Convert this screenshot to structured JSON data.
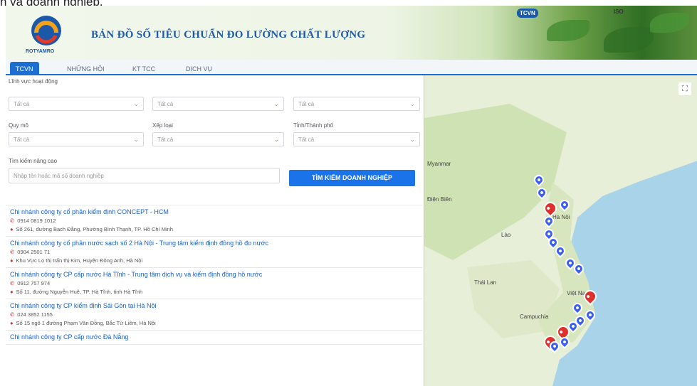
{
  "page": {
    "caption": "n và doanh nghiệp."
  },
  "banner": {
    "logo_text": "ROTYAMRO",
    "title": "BẢN ĐỒ SỐ TIÊU CHUẨN ĐO LƯỜNG CHẤT LƯỢNG",
    "badges": [
      "TCVN",
      "ISO"
    ]
  },
  "tabs": [
    {
      "label": "TCVN"
    },
    {
      "label": "NHỮNG HỘI"
    },
    {
      "label": "KT TCC"
    },
    {
      "label": "DỊCH VỤ"
    }
  ],
  "filters": {
    "group1_label": "Lĩnh vực hoạt động",
    "select1": "Tất cả",
    "select2": "Tất cả",
    "select3": "Tất cả",
    "label_a": "Quy mô",
    "label_b": "Xếp loại",
    "label_c": "Tỉnh/Thành phố",
    "select4": "Tất cả",
    "select5": "Tất cả",
    "select6": "Tất cả",
    "search_label": "Tìm kiếm nâng cao",
    "search_placeholder": "Nhập tên hoặc mã số doanh nghiệp",
    "search_button": "TÌM KIẾM DOANH NGHIỆP"
  },
  "results": [
    {
      "title": "Chi nhánh công ty cổ phần kiểm định CONCEPT - HCM",
      "phone": "0914 0819 1012",
      "address": "Số 261, đường Bạch Đằng, Phường Bình Thạnh, TP. Hồ Chí Minh"
    },
    {
      "title": "Chi nhánh công ty cổ phần nước sạch số 2 Hà Nội - Trung tâm kiểm định đồng hồ đo nước",
      "phone": "0904 2501 71",
      "address": "Khu Vực Lọ thị trấn thị Kim, Huyện Đông Anh, Hà Nội"
    },
    {
      "title": "Chi nhánh công ty CP cấp nước Hà Tĩnh - Trung tâm dịch vụ và kiểm định đồng hồ nước",
      "phone": "0912 757 974",
      "address": "Số 11, đường Nguyễn Huệ, TP. Hà Tĩnh, tỉnh Hà Tĩnh"
    },
    {
      "title": "Chi nhánh công ty CP kiểm định Sài Gòn tại Hà Nội",
      "phone": "024 3852 1155",
      "address": "Số 15 ngõ 1 đường Phạm Văn Đồng, Bắc Từ Liêm, Hà Nội"
    },
    {
      "title": "Chi nhánh công ty CP cấp nước Đà Nẵng",
      "phone": "",
      "address": ""
    }
  ],
  "map": {
    "labels": [
      "Điện Biên",
      "Lào",
      "Thái Lan",
      "Campuchia",
      "Việt Nam",
      "Hà Nội",
      "Myanmar"
    ]
  }
}
